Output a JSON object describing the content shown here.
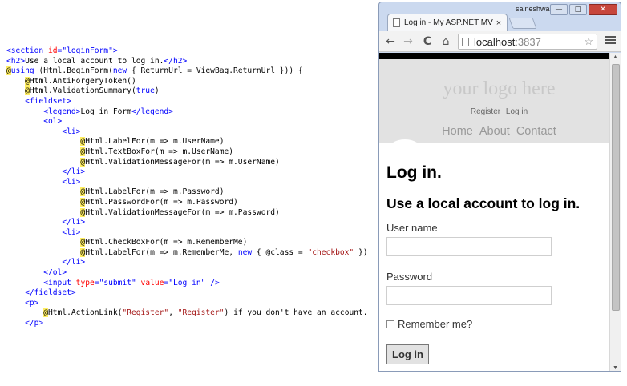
{
  "code": {
    "lines": [
      [
        {
          "t": "<",
          "c": "t"
        },
        {
          "t": "section",
          "c": "t"
        },
        {
          "t": " id",
          "c": "a"
        },
        {
          "t": "=",
          "c": "t"
        },
        {
          "t": "\"loginForm\"",
          "c": "t"
        },
        {
          "t": ">",
          "c": "t"
        }
      ],
      [
        {
          "t": "<h2>",
          "c": "t"
        },
        {
          "t": "Use a local account to log in.",
          "c": ""
        },
        {
          "t": "</h2>",
          "c": "t"
        }
      ],
      [
        {
          "t": "@",
          "c": "at"
        },
        {
          "t": "using",
          "c": "k"
        },
        {
          "t": " (Html.BeginForm(",
          "c": ""
        },
        {
          "t": "new",
          "c": "k"
        },
        {
          "t": " { ReturnUrl = ViewBag.ReturnUrl })) {",
          "c": ""
        }
      ],
      [
        {
          "t": "    ",
          "c": ""
        },
        {
          "t": "@",
          "c": "at"
        },
        {
          "t": "Html.AntiForgeryToken()",
          "c": ""
        }
      ],
      [
        {
          "t": "    ",
          "c": ""
        },
        {
          "t": "@",
          "c": "at"
        },
        {
          "t": "Html.ValidationSummary(",
          "c": ""
        },
        {
          "t": "true",
          "c": "k"
        },
        {
          "t": ")",
          "c": ""
        }
      ],
      [
        {
          "t": "    ",
          "c": ""
        },
        {
          "t": "<fieldset>",
          "c": "t"
        }
      ],
      [
        {
          "t": "        ",
          "c": ""
        },
        {
          "t": "<legend>",
          "c": "t"
        },
        {
          "t": "Log in Form",
          "c": ""
        },
        {
          "t": "</legend>",
          "c": "t"
        }
      ],
      [
        {
          "t": "        ",
          "c": ""
        },
        {
          "t": "<ol>",
          "c": "t"
        }
      ],
      [
        {
          "t": "            ",
          "c": ""
        },
        {
          "t": "<li>",
          "c": "t"
        }
      ],
      [
        {
          "t": "                ",
          "c": ""
        },
        {
          "t": "@",
          "c": "at"
        },
        {
          "t": "Html.LabelFor(m => m.UserName)",
          "c": ""
        }
      ],
      [
        {
          "t": "                ",
          "c": ""
        },
        {
          "t": "@",
          "c": "at"
        },
        {
          "t": "Html.TextBoxFor(m => m.UserName)",
          "c": ""
        }
      ],
      [
        {
          "t": "                ",
          "c": ""
        },
        {
          "t": "@",
          "c": "at"
        },
        {
          "t": "Html.ValidationMessageFor(m => m.UserName)",
          "c": ""
        }
      ],
      [
        {
          "t": "            ",
          "c": ""
        },
        {
          "t": "</li>",
          "c": "t"
        }
      ],
      [
        {
          "t": "            ",
          "c": ""
        },
        {
          "t": "<li>",
          "c": "t"
        }
      ],
      [
        {
          "t": "                ",
          "c": ""
        },
        {
          "t": "@",
          "c": "at"
        },
        {
          "t": "Html.LabelFor(m => m.Password)",
          "c": ""
        }
      ],
      [
        {
          "t": "                ",
          "c": ""
        },
        {
          "t": "@",
          "c": "at"
        },
        {
          "t": "Html.PasswordFor(m => m.Password)",
          "c": ""
        }
      ],
      [
        {
          "t": "                ",
          "c": ""
        },
        {
          "t": "@",
          "c": "at"
        },
        {
          "t": "Html.ValidationMessageFor(m => m.Password)",
          "c": ""
        }
      ],
      [
        {
          "t": "            ",
          "c": ""
        },
        {
          "t": "</li>",
          "c": "t"
        }
      ],
      [
        {
          "t": "            ",
          "c": ""
        },
        {
          "t": "<li>",
          "c": "t"
        }
      ],
      [
        {
          "t": "                ",
          "c": ""
        },
        {
          "t": "@",
          "c": "at"
        },
        {
          "t": "Html.CheckBoxFor(m => m.RememberMe)",
          "c": ""
        }
      ],
      [
        {
          "t": "                ",
          "c": ""
        },
        {
          "t": "@",
          "c": "at"
        },
        {
          "t": "Html.LabelFor(m => m.RememberMe, ",
          "c": ""
        },
        {
          "t": "new",
          "c": "k"
        },
        {
          "t": " { @class = ",
          "c": ""
        },
        {
          "t": "\"checkbox\"",
          "c": "s"
        },
        {
          "t": " })",
          "c": ""
        }
      ],
      [
        {
          "t": "            ",
          "c": ""
        },
        {
          "t": "</li>",
          "c": "t"
        }
      ],
      [
        {
          "t": "        ",
          "c": ""
        },
        {
          "t": "</ol>",
          "c": "t"
        }
      ],
      [
        {
          "t": "        ",
          "c": ""
        },
        {
          "t": "<",
          "c": "t"
        },
        {
          "t": "input",
          "c": "t"
        },
        {
          "t": " type",
          "c": "a"
        },
        {
          "t": "=",
          "c": "t"
        },
        {
          "t": "\"submit\"",
          "c": "t"
        },
        {
          "t": " value",
          "c": "a"
        },
        {
          "t": "=",
          "c": "t"
        },
        {
          "t": "\"Log in\"",
          "c": "t"
        },
        {
          "t": " />",
          "c": "t"
        }
      ],
      [
        {
          "t": "    ",
          "c": ""
        },
        {
          "t": "</fieldset>",
          "c": "t"
        }
      ],
      [
        {
          "t": "    ",
          "c": ""
        },
        {
          "t": "<p>",
          "c": "t"
        }
      ],
      [
        {
          "t": "        ",
          "c": ""
        },
        {
          "t": "@",
          "c": "at"
        },
        {
          "t": "Html.ActionLink(",
          "c": ""
        },
        {
          "t": "\"Register\"",
          "c": "s"
        },
        {
          "t": ", ",
          "c": ""
        },
        {
          "t": "\"Register\"",
          "c": "s"
        },
        {
          "t": ") if you don't have an account.",
          "c": ""
        }
      ],
      [
        {
          "t": "    ",
          "c": ""
        },
        {
          "t": "</p>",
          "c": "t"
        }
      ]
    ]
  },
  "browser": {
    "user": "saineshwar",
    "tab_title": "Log in - My ASP.NET MVC A",
    "tab_close": "×",
    "url_host": "localhost",
    "url_port": ":3837",
    "buttons": {
      "minimize": "—",
      "maximize": "□",
      "close": "✕"
    },
    "nav": {
      "back": "←",
      "forward": "→",
      "reload": "C",
      "home": "⌂",
      "star": "☆"
    },
    "icons": {
      "back": "back-arrow-icon",
      "forward": "forward-arrow-icon",
      "reload": "reload-icon",
      "home": "home-icon",
      "star": "star-icon",
      "menu": "hamburger-menu-icon"
    }
  },
  "page": {
    "logo": "your logo here",
    "register": "Register",
    "login": "Log in",
    "nav": [
      "Home",
      "About",
      "Contact"
    ],
    "h1": "Log in.",
    "h2": "Use a local account to log in.",
    "username_label": "User name",
    "password_label": "Password",
    "remember_label": "Remember me?",
    "submit": "Log in"
  },
  "scroll": {
    "up": "▲",
    "down": "▼"
  }
}
